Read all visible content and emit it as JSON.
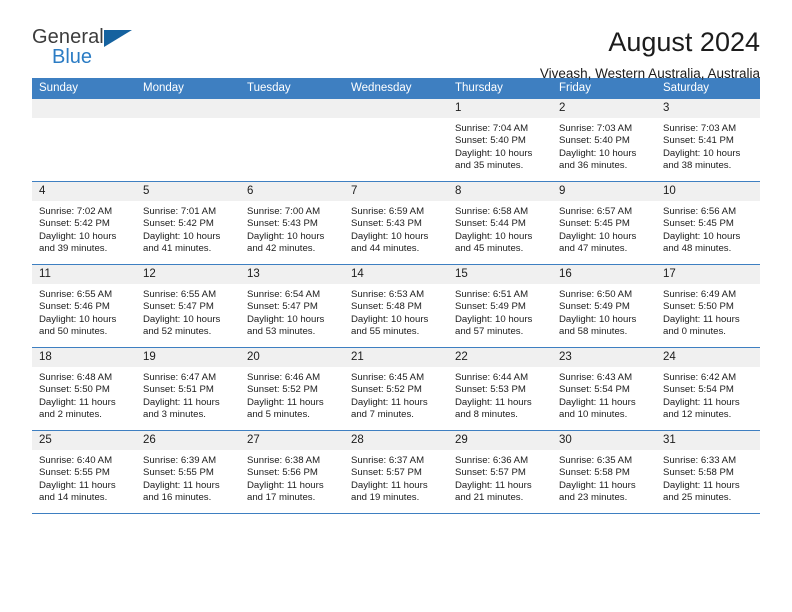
{
  "brand": {
    "name_top": "General",
    "name_bottom": "Blue",
    "flag_icon": "triangle-flag-icon",
    "accent_blue": "#2b7cc4",
    "flag_blue": "#15629f"
  },
  "header": {
    "title": "August 2024",
    "subtitle": "Viveash, Western Australia, Australia"
  },
  "theme": {
    "header_band": "#3e7fc1",
    "daynum_strip": "#f0f0f0",
    "rule": "#3e7fc1"
  },
  "weekdays": [
    "Sunday",
    "Monday",
    "Tuesday",
    "Wednesday",
    "Thursday",
    "Friday",
    "Saturday"
  ],
  "weeks": [
    [
      {
        "day": "",
        "sunrise": "",
        "sunset": "",
        "daylight1": "",
        "daylight2": ""
      },
      {
        "day": "",
        "sunrise": "",
        "sunset": "",
        "daylight1": "",
        "daylight2": ""
      },
      {
        "day": "",
        "sunrise": "",
        "sunset": "",
        "daylight1": "",
        "daylight2": ""
      },
      {
        "day": "",
        "sunrise": "",
        "sunset": "",
        "daylight1": "",
        "daylight2": ""
      },
      {
        "day": "1",
        "sunrise": "Sunrise: 7:04 AM",
        "sunset": "Sunset: 5:40 PM",
        "daylight1": "Daylight: 10 hours",
        "daylight2": "and 35 minutes."
      },
      {
        "day": "2",
        "sunrise": "Sunrise: 7:03 AM",
        "sunset": "Sunset: 5:40 PM",
        "daylight1": "Daylight: 10 hours",
        "daylight2": "and 36 minutes."
      },
      {
        "day": "3",
        "sunrise": "Sunrise: 7:03 AM",
        "sunset": "Sunset: 5:41 PM",
        "daylight1": "Daylight: 10 hours",
        "daylight2": "and 38 minutes."
      }
    ],
    [
      {
        "day": "4",
        "sunrise": "Sunrise: 7:02 AM",
        "sunset": "Sunset: 5:42 PM",
        "daylight1": "Daylight: 10 hours",
        "daylight2": "and 39 minutes."
      },
      {
        "day": "5",
        "sunrise": "Sunrise: 7:01 AM",
        "sunset": "Sunset: 5:42 PM",
        "daylight1": "Daylight: 10 hours",
        "daylight2": "and 41 minutes."
      },
      {
        "day": "6",
        "sunrise": "Sunrise: 7:00 AM",
        "sunset": "Sunset: 5:43 PM",
        "daylight1": "Daylight: 10 hours",
        "daylight2": "and 42 minutes."
      },
      {
        "day": "7",
        "sunrise": "Sunrise: 6:59 AM",
        "sunset": "Sunset: 5:43 PM",
        "daylight1": "Daylight: 10 hours",
        "daylight2": "and 44 minutes."
      },
      {
        "day": "8",
        "sunrise": "Sunrise: 6:58 AM",
        "sunset": "Sunset: 5:44 PM",
        "daylight1": "Daylight: 10 hours",
        "daylight2": "and 45 minutes."
      },
      {
        "day": "9",
        "sunrise": "Sunrise: 6:57 AM",
        "sunset": "Sunset: 5:45 PM",
        "daylight1": "Daylight: 10 hours",
        "daylight2": "and 47 minutes."
      },
      {
        "day": "10",
        "sunrise": "Sunrise: 6:56 AM",
        "sunset": "Sunset: 5:45 PM",
        "daylight1": "Daylight: 10 hours",
        "daylight2": "and 48 minutes."
      }
    ],
    [
      {
        "day": "11",
        "sunrise": "Sunrise: 6:55 AM",
        "sunset": "Sunset: 5:46 PM",
        "daylight1": "Daylight: 10 hours",
        "daylight2": "and 50 minutes."
      },
      {
        "day": "12",
        "sunrise": "Sunrise: 6:55 AM",
        "sunset": "Sunset: 5:47 PM",
        "daylight1": "Daylight: 10 hours",
        "daylight2": "and 52 minutes."
      },
      {
        "day": "13",
        "sunrise": "Sunrise: 6:54 AM",
        "sunset": "Sunset: 5:47 PM",
        "daylight1": "Daylight: 10 hours",
        "daylight2": "and 53 minutes."
      },
      {
        "day": "14",
        "sunrise": "Sunrise: 6:53 AM",
        "sunset": "Sunset: 5:48 PM",
        "daylight1": "Daylight: 10 hours",
        "daylight2": "and 55 minutes."
      },
      {
        "day": "15",
        "sunrise": "Sunrise: 6:51 AM",
        "sunset": "Sunset: 5:49 PM",
        "daylight1": "Daylight: 10 hours",
        "daylight2": "and 57 minutes."
      },
      {
        "day": "16",
        "sunrise": "Sunrise: 6:50 AM",
        "sunset": "Sunset: 5:49 PM",
        "daylight1": "Daylight: 10 hours",
        "daylight2": "and 58 minutes."
      },
      {
        "day": "17",
        "sunrise": "Sunrise: 6:49 AM",
        "sunset": "Sunset: 5:50 PM",
        "daylight1": "Daylight: 11 hours",
        "daylight2": "and 0 minutes."
      }
    ],
    [
      {
        "day": "18",
        "sunrise": "Sunrise: 6:48 AM",
        "sunset": "Sunset: 5:50 PM",
        "daylight1": "Daylight: 11 hours",
        "daylight2": "and 2 minutes."
      },
      {
        "day": "19",
        "sunrise": "Sunrise: 6:47 AM",
        "sunset": "Sunset: 5:51 PM",
        "daylight1": "Daylight: 11 hours",
        "daylight2": "and 3 minutes."
      },
      {
        "day": "20",
        "sunrise": "Sunrise: 6:46 AM",
        "sunset": "Sunset: 5:52 PM",
        "daylight1": "Daylight: 11 hours",
        "daylight2": "and 5 minutes."
      },
      {
        "day": "21",
        "sunrise": "Sunrise: 6:45 AM",
        "sunset": "Sunset: 5:52 PM",
        "daylight1": "Daylight: 11 hours",
        "daylight2": "and 7 minutes."
      },
      {
        "day": "22",
        "sunrise": "Sunrise: 6:44 AM",
        "sunset": "Sunset: 5:53 PM",
        "daylight1": "Daylight: 11 hours",
        "daylight2": "and 8 minutes."
      },
      {
        "day": "23",
        "sunrise": "Sunrise: 6:43 AM",
        "sunset": "Sunset: 5:54 PM",
        "daylight1": "Daylight: 11 hours",
        "daylight2": "and 10 minutes."
      },
      {
        "day": "24",
        "sunrise": "Sunrise: 6:42 AM",
        "sunset": "Sunset: 5:54 PM",
        "daylight1": "Daylight: 11 hours",
        "daylight2": "and 12 minutes."
      }
    ],
    [
      {
        "day": "25",
        "sunrise": "Sunrise: 6:40 AM",
        "sunset": "Sunset: 5:55 PM",
        "daylight1": "Daylight: 11 hours",
        "daylight2": "and 14 minutes."
      },
      {
        "day": "26",
        "sunrise": "Sunrise: 6:39 AM",
        "sunset": "Sunset: 5:55 PM",
        "daylight1": "Daylight: 11 hours",
        "daylight2": "and 16 minutes."
      },
      {
        "day": "27",
        "sunrise": "Sunrise: 6:38 AM",
        "sunset": "Sunset: 5:56 PM",
        "daylight1": "Daylight: 11 hours",
        "daylight2": "and 17 minutes."
      },
      {
        "day": "28",
        "sunrise": "Sunrise: 6:37 AM",
        "sunset": "Sunset: 5:57 PM",
        "daylight1": "Daylight: 11 hours",
        "daylight2": "and 19 minutes."
      },
      {
        "day": "29",
        "sunrise": "Sunrise: 6:36 AM",
        "sunset": "Sunset: 5:57 PM",
        "daylight1": "Daylight: 11 hours",
        "daylight2": "and 21 minutes."
      },
      {
        "day": "30",
        "sunrise": "Sunrise: 6:35 AM",
        "sunset": "Sunset: 5:58 PM",
        "daylight1": "Daylight: 11 hours",
        "daylight2": "and 23 minutes."
      },
      {
        "day": "31",
        "sunrise": "Sunrise: 6:33 AM",
        "sunset": "Sunset: 5:58 PM",
        "daylight1": "Daylight: 11 hours",
        "daylight2": "and 25 minutes."
      }
    ]
  ]
}
